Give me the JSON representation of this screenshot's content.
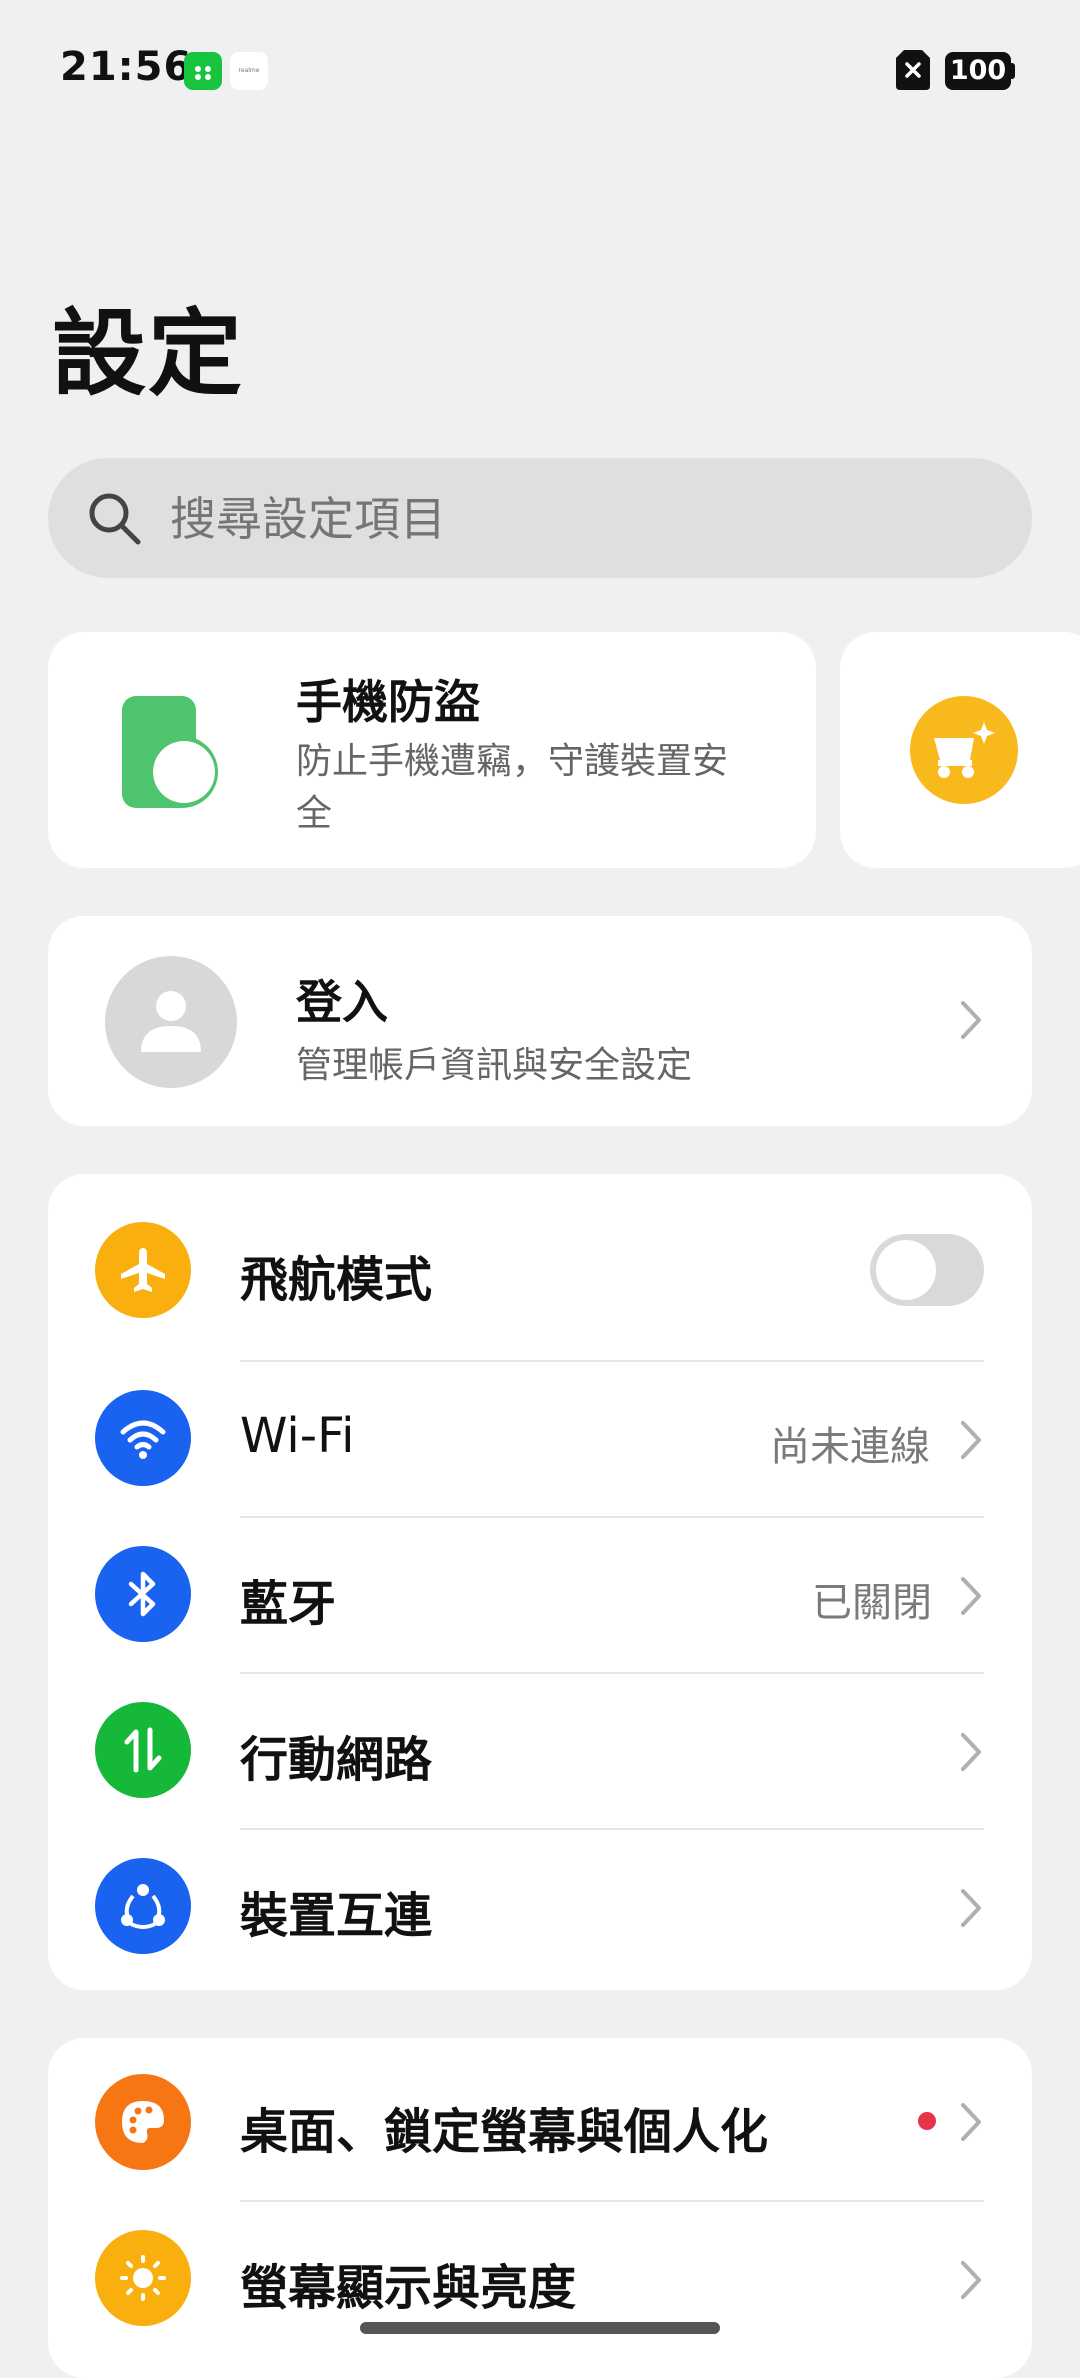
{
  "status_bar": {
    "time": "21:56",
    "battery": "100",
    "notif_text": "realme"
  },
  "title": "設定",
  "search": {
    "placeholder": "搜尋設定項目"
  },
  "promo_cards": [
    {
      "title": "手機防盜",
      "desc": "防止手機遭竊，守護裝置安全"
    }
  ],
  "login": {
    "title": "登入",
    "subtitle": "管理帳戶資訊與安全設定"
  },
  "connectivity": [
    {
      "label": "飛航模式",
      "value": "",
      "icon": "airplane-icon",
      "color": "#f9b00f",
      "toggle": false
    },
    {
      "label": "Wi-Fi",
      "value": "尚未連線",
      "icon": "wifi-icon",
      "color": "#1a63f0"
    },
    {
      "label": "藍牙",
      "value": "已關閉",
      "icon": "bluetooth-icon",
      "color": "#1a63f0"
    },
    {
      "label": "行動網路",
      "value": "",
      "icon": "mobile-data-icon",
      "color": "#16b83a"
    },
    {
      "label": "裝置互連",
      "value": "",
      "icon": "device-connect-icon",
      "color": "#1a63f0"
    }
  ],
  "display": [
    {
      "label": "桌面、鎖定螢幕與個人化",
      "icon": "palette-icon",
      "color": "#f77614",
      "badge": true
    },
    {
      "label": "螢幕顯示與亮度",
      "icon": "sun-icon",
      "color": "#f9b00f"
    }
  ]
}
